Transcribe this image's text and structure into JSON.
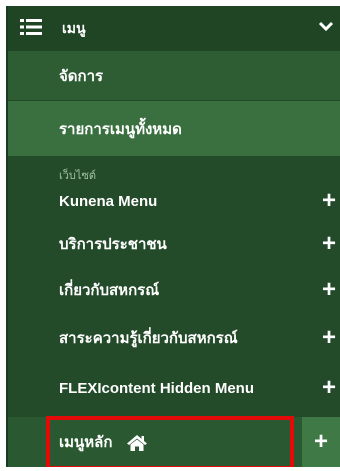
{
  "header": {
    "title": "เมนู",
    "menu_icon": "list-menu-icon",
    "collapse_icon": "chevron-down-icon"
  },
  "admin_items": [
    {
      "label": "จัดการ"
    },
    {
      "label": "รายการเมนูทั้งหมด"
    }
  ],
  "section_label": "เว็บไซต์",
  "site_items": [
    {
      "label": "Kunena Menu",
      "plus": "+"
    },
    {
      "label": "บริการประชาชน",
      "plus": "+"
    },
    {
      "label": "เกี่ยวกับสหกรณ์",
      "plus": "+"
    },
    {
      "label": "สาระความรู้เกี่ยวกับสหกรณ์",
      "plus": "+"
    },
    {
      "label": "FLEXIcontent Hidden Menu",
      "plus": "+"
    },
    {
      "label": "เมนูหลัก",
      "plus": "+",
      "icon": "home-icon"
    }
  ],
  "colors": {
    "header_bg": "#1f4525",
    "panel_bg": "#2c5a32",
    "highlight": "#e30a0a"
  }
}
